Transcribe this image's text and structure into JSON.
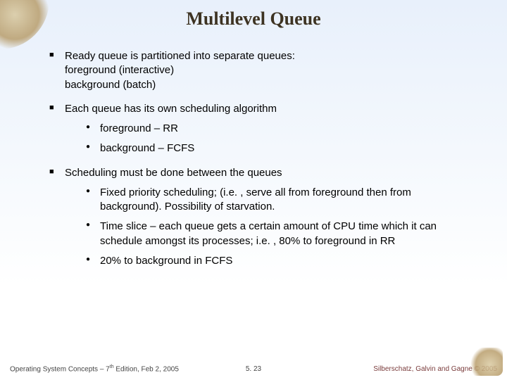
{
  "title": "Multilevel Queue",
  "bullets": [
    {
      "head": "Ready queue is partitioned into separate queues:",
      "subs": [
        "foreground (interactive)",
        "background (batch)"
      ],
      "children": []
    },
    {
      "head": "Each queue has its own scheduling algorithm",
      "subs": [],
      "children": [
        "foreground – RR",
        "background – FCFS"
      ]
    },
    {
      "head": "Scheduling must be done between the queues",
      "subs": [],
      "children": [
        "Fixed priority scheduling; (i.e. , serve all from foreground then from background).  Possibility of starvation.",
        "Time slice – each queue gets a certain amount of CPU time which it can schedule amongst its processes; i.e. , 80% to foreground in RR",
        "20% to background in FCFS"
      ]
    }
  ],
  "footer": {
    "left_prefix": "Operating System Concepts – 7",
    "left_sup": "th",
    "left_suffix": " Edition, Feb 2, 2005",
    "center": "5. 23",
    "right": "Silberschatz, Galvin and Gagne © 2005"
  }
}
